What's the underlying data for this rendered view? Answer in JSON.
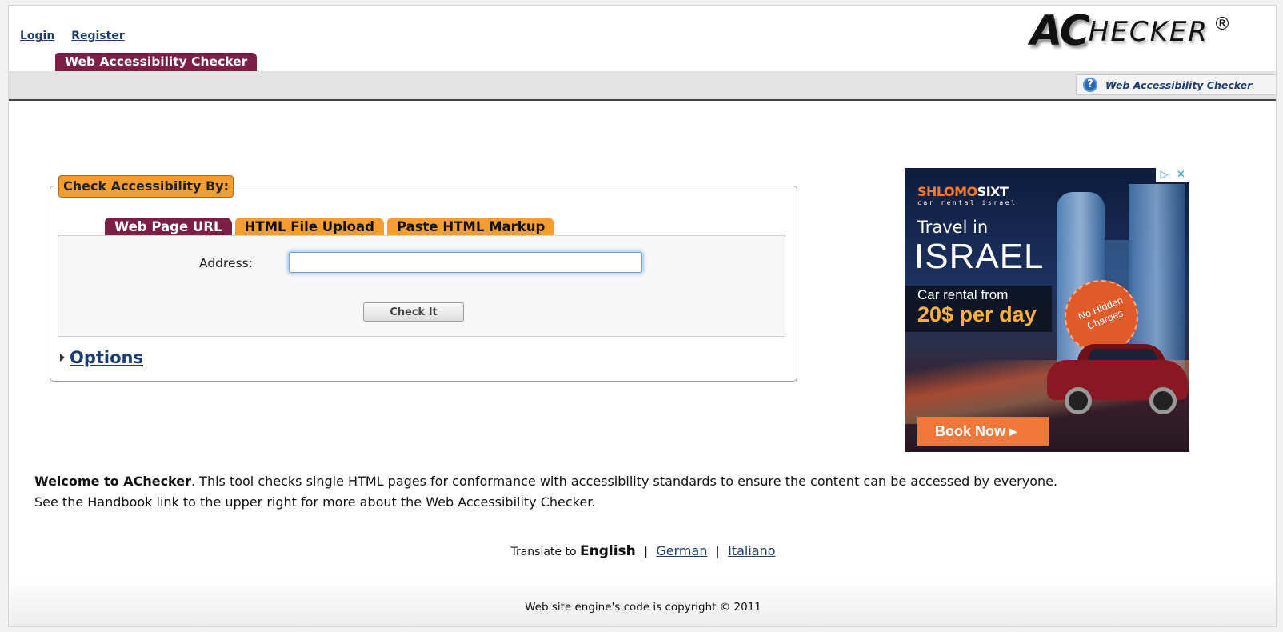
{
  "header": {
    "links": [
      "Login",
      "Register"
    ],
    "logo": {
      "big": "AC",
      "rest": "HECKER",
      "reg": "®"
    },
    "tab_label": "Web Accessibility Checker",
    "handbook_label": "Web Accessibility Checker",
    "handbook_icon": "help-icon"
  },
  "form": {
    "legend": "Check Accessibility By:",
    "tabs": [
      {
        "label": "Web Page URL",
        "active": true
      },
      {
        "label": "HTML File Upload",
        "active": false
      },
      {
        "label": "Paste HTML Markup",
        "active": false
      }
    ],
    "address_label": "Address:",
    "address_value": "",
    "check_button": "Check It",
    "options_label": "Options"
  },
  "ad": {
    "brand_a": "SHLOMO",
    "brand_b": "SIXT",
    "brand_sub": "car rental israel",
    "line1": "Travel in",
    "line2": "ISRAEL",
    "line3": "Car rental from",
    "line4": "20$ per day",
    "badge": "No Hidden Charges",
    "cta": "Book Now ▸",
    "adchoices": [
      "▷",
      "✕"
    ]
  },
  "welcome": {
    "bold": "Welcome to AChecker",
    "text": ". This tool checks single HTML pages for conformance with accessibility standards to ensure the content can be accessed by everyone.",
    "line2": "See the Handbook link to the upper right for more about the Web Accessibility Checker."
  },
  "translate": {
    "prefix": "Translate to",
    "current": "English",
    "others": [
      "German",
      "Italiano"
    ]
  },
  "footer": {
    "copyright": "Web site engine's code is copyright © 2011"
  },
  "colors": {
    "accent_dark": "#7b1f47",
    "accent_orange": "#f49d32",
    "link": "#1e3d6e"
  }
}
